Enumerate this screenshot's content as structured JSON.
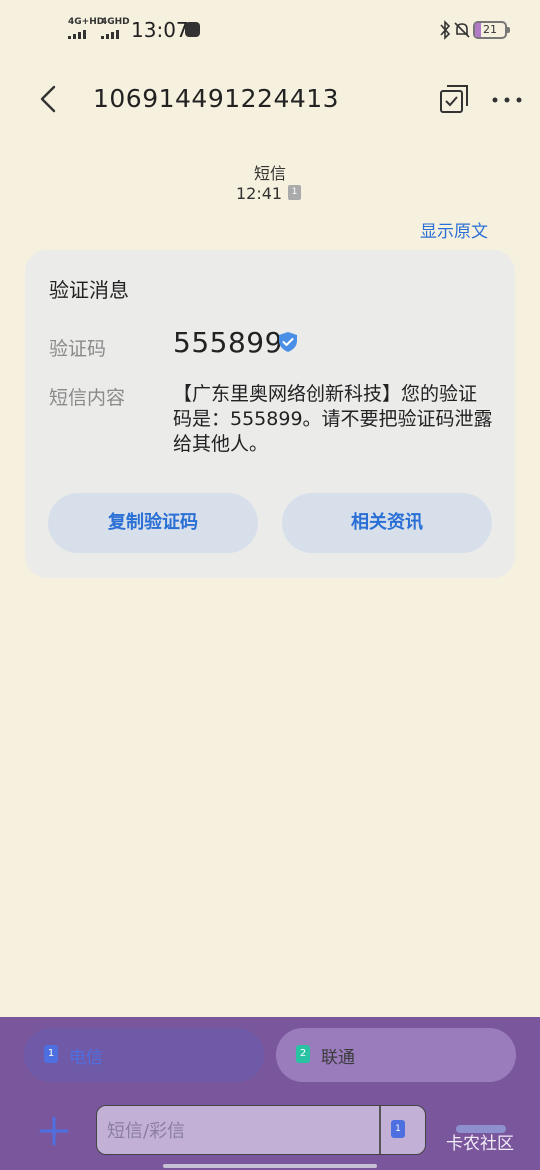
{
  "status_bar": {
    "network_1": "4G+HD",
    "network_2": "4GHD",
    "time": "13:07",
    "battery": "21"
  },
  "header": {
    "title": "106914491224413"
  },
  "message_meta": {
    "label": "短信",
    "time": "12:41",
    "sim_slot": "1"
  },
  "show_original_label": "显示原文",
  "card": {
    "title": "验证消息",
    "code_label": "验证码",
    "code_value": "555899",
    "content_label": "短信内容",
    "content_value": "【广东里奥网络创新科技】您的验证码是：555899。请不要把验证码泄露给其他人。",
    "copy_button": "复制验证码",
    "related_button": "相关资讯"
  },
  "bottom": {
    "sim_tabs": [
      {
        "slot": "1",
        "name": "电信"
      },
      {
        "slot": "2",
        "name": "联通"
      }
    ],
    "input_placeholder": "短信/彩信",
    "sim_select": "1",
    "watermark": "卡农社区"
  },
  "colors": {
    "background": "#f6f1de",
    "accent": "#2a6fd6",
    "bottom_panel": "#7a579d"
  }
}
